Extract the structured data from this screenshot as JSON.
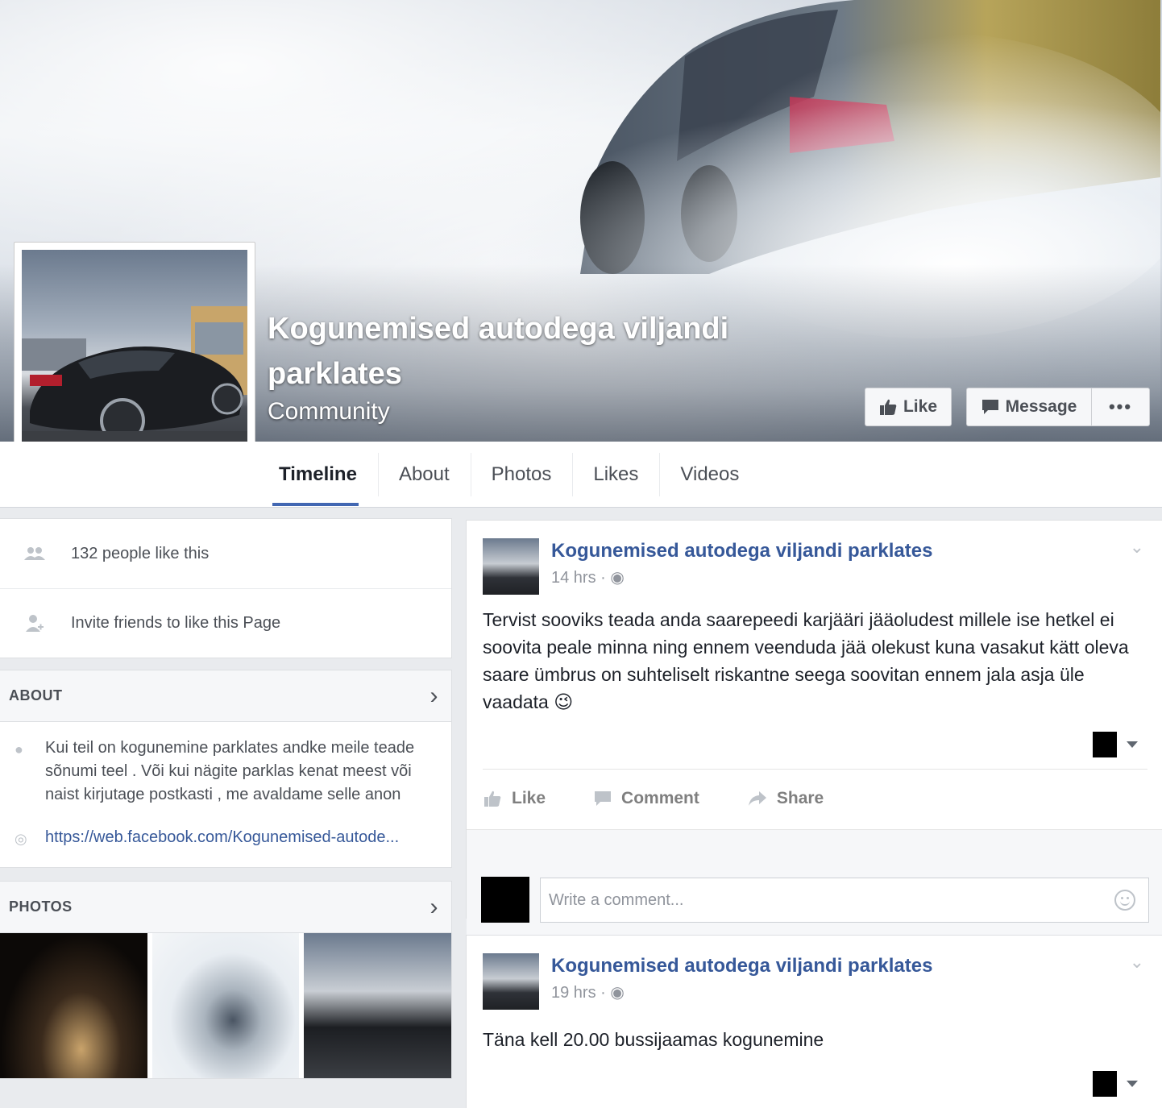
{
  "page": {
    "name": "Kogunemised autodega viljandi parklates",
    "category": "Community",
    "buttons": {
      "like": "Like",
      "message": "Message",
      "more": "•••"
    }
  },
  "nav": {
    "tabs": [
      "Timeline",
      "About",
      "Photos",
      "Likes",
      "Videos"
    ],
    "active": "Timeline"
  },
  "sidebar": {
    "likes_count": "132 people like this",
    "invite": "Invite friends to like this Page",
    "about": {
      "heading": "ABOUT",
      "description": "Kui teil on kogunemine parklates andke meile teade sõnumi teel . Või kui nägite parklas kenat meest või naist kirjutage postkasti , me avaldame selle anon",
      "link": "https://web.facebook.com/Kogunemised-autode..."
    },
    "photos": {
      "heading": "PHOTOS"
    }
  },
  "posts": [
    {
      "author": "Kogunemised autodega viljandi parklates",
      "time": "14 hrs · ",
      "text": "Tervist sooviks teada anda saarepeedi karjääri jääoludest millele ise hetkel ei soovita peale minna ning ennem veenduda jää olekust kuna vasakut kätt oleva saare ümbrus on suhteliselt riskantne seega soovitan ennem jala asja üle vaadata 😉",
      "actions": {
        "like": "Like",
        "comment": "Comment",
        "share": "Share"
      },
      "comment_placeholder": "Write a comment..."
    },
    {
      "author": "Kogunemised autodega viljandi parklates",
      "time": "19 hrs · ",
      "text": "Täna kell 20.00 bussijaamas kogunemine"
    }
  ],
  "colors": {
    "link_blue": "#365899",
    "tab_underline": "#4267b2",
    "page_bg": "#e9ebee"
  }
}
